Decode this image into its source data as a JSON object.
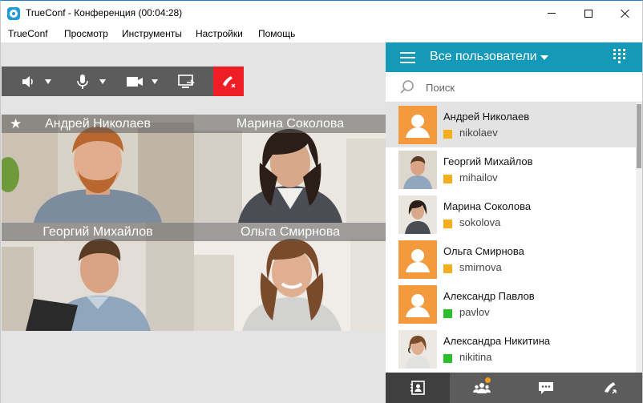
{
  "window": {
    "title": "TrueConf - Конференция (00:04:28)"
  },
  "menu": [
    "TrueConf",
    "Просмотр",
    "Инструменты",
    "Настройки",
    "Помощь"
  ],
  "toolbar": {
    "buttons": [
      "speaker-icon",
      "microphone-icon",
      "camera-icon",
      "screen-share-icon",
      "hangup-icon"
    ],
    "hangup_color": "#ef1d25"
  },
  "conference": {
    "participants": [
      {
        "name": "Андрей Николаев",
        "starred": true
      },
      {
        "name": "Марина Соколова",
        "starred": false
      },
      {
        "name": "Георгий Михайлов",
        "starred": false
      },
      {
        "name": "Ольга Смирнова",
        "starred": false
      }
    ],
    "star_symbol": "★"
  },
  "panel": {
    "title": "Все пользователи",
    "accent": "#1499b8",
    "search_placeholder": "Поиск",
    "contacts": [
      {
        "name": "Андрей Николаев",
        "login": "nikolaev",
        "status": "away",
        "status_color": "#f4ae1f",
        "avatar": "placeholder",
        "selected": true
      },
      {
        "name": "Георгий Михайлов",
        "login": "mihailov",
        "status": "away",
        "status_color": "#f4ae1f",
        "avatar": "photo",
        "selected": false
      },
      {
        "name": "Марина Соколова",
        "login": "sokolova",
        "status": "away",
        "status_color": "#f4ae1f",
        "avatar": "photo",
        "selected": false
      },
      {
        "name": "Ольга Смирнова",
        "login": "smirnova",
        "status": "away",
        "status_color": "#f4ae1f",
        "avatar": "placeholder",
        "selected": false
      },
      {
        "name": "Александр Павлов",
        "login": "pavlov",
        "status": "online",
        "status_color": "#2bc02b",
        "avatar": "placeholder",
        "selected": false
      },
      {
        "name": "Александра Никитина",
        "login": "nikitina",
        "status": "online",
        "status_color": "#2bc02b",
        "avatar": "photo",
        "selected": false
      }
    ],
    "bottom_tabs": [
      "contacts-icon",
      "group-icon",
      "chat-icon",
      "call-history-icon"
    ],
    "notification_color": "#f29f15"
  }
}
